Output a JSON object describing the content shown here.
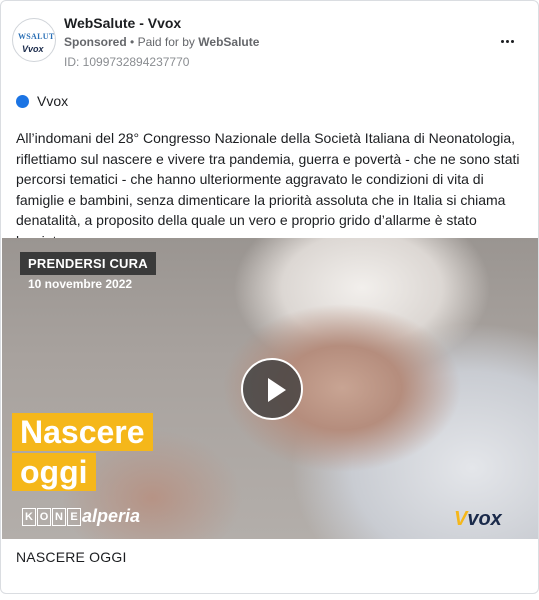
{
  "post": {
    "page_name": "WebSalute - Vvox",
    "sponsored": "Sponsored",
    "paid_for_prefix": "Paid for by",
    "paid_for_by": "WebSalute",
    "ad_id": "ID: 1099732894237770",
    "avatar_top": "WSALUTE",
    "avatar_bottom": "Vvox",
    "more_icon": "more-horizontal-icon"
  },
  "platform": {
    "name": "Vvox",
    "dot_color": "#1b74e4"
  },
  "body_text": "All’indomani del 28° Congresso Nazionale della Società Italiana di Neonatologia, riflettiamo sul nascere e vivere tra pandemia, guerra e povertà - che ne sono stati percorsi tematici - che hanno ulteriormente aggravato le condizioni di vita di famiglie e bambini, senza dimenticare la priorità assoluta che in Italia si chiama denatalità, a proposito della quale un vero e proprio grido d’allarme è stato lanciat…",
  "media": {
    "tag": "PRENDERSI CURA",
    "date": "10 novembre 2022",
    "title_line1": "Nascere",
    "title_line2": "oggi",
    "sponsor1": [
      "K",
      "O",
      "N",
      "E"
    ],
    "sponsor2": "alperia",
    "brand_v": "V",
    "brand_rest": "vox",
    "accent_color": "#f5b71a",
    "play_icon": "play-icon"
  },
  "caption": "NASCERE OGGI"
}
